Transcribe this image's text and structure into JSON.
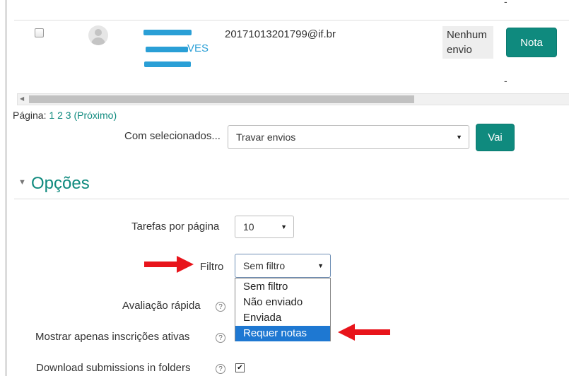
{
  "table": {
    "row": {
      "email": "20171013201799@if.br",
      "name_visible_fragment": "VES",
      "status_line1": "Nenhum",
      "status_line2": "envio",
      "grade_button": "Nota",
      "dash_top": "-",
      "dash_bottom": "-"
    }
  },
  "pagination": {
    "label": "Página:",
    "pages": [
      "1",
      "2",
      "3"
    ],
    "next": "(Próximo)"
  },
  "bulk": {
    "label": "Com selecionados...",
    "selected_action": "Travar envios",
    "go_button": "Vai"
  },
  "options": {
    "heading": "Opções",
    "per_page_label": "Tarefas por página",
    "per_page_value": "10",
    "filter_label": "Filtro",
    "filter_value": "Sem filtro",
    "filter_options": [
      "Sem filtro",
      "Não enviado",
      "Enviada",
      "Requer notas"
    ],
    "filter_highlighted": "Requer notas",
    "quick_grading_label": "Avaliação rápida",
    "active_only_label": "Mostrar apenas inscrições ativas",
    "download_folders_label": "Download submissions in folders",
    "download_folders_checked": true,
    "help_glyph": "?"
  },
  "colors": {
    "accent": "#0f8a7e",
    "arrow": "#e8141b",
    "highlight": "#1e78d2",
    "redaction": "#2a9fd6"
  }
}
